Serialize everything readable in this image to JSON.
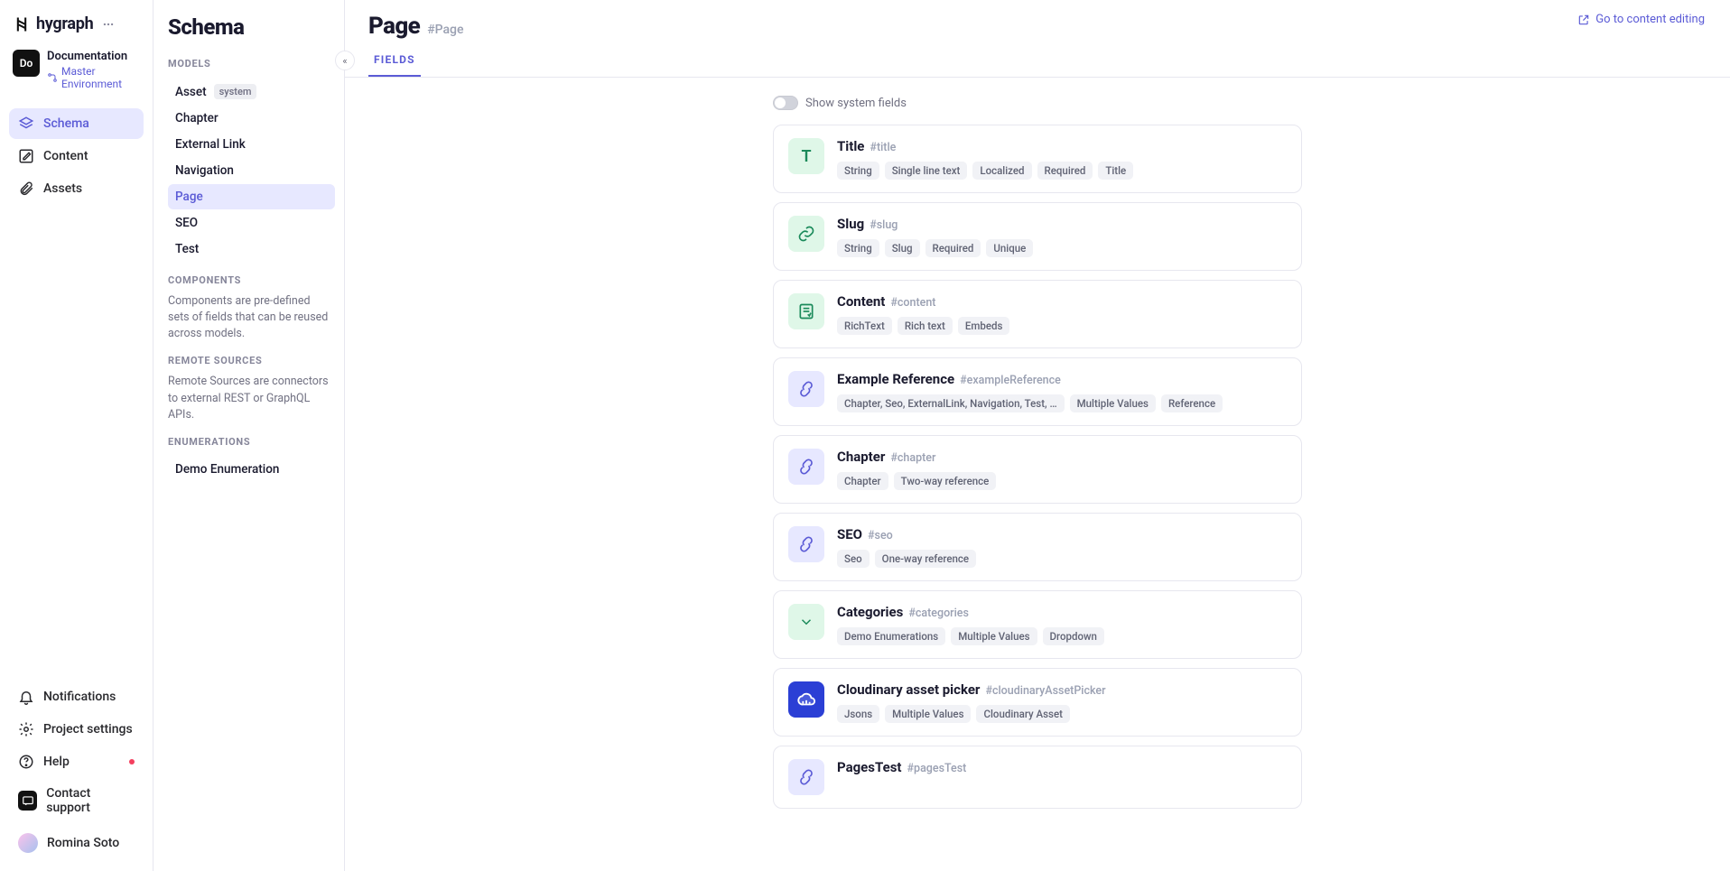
{
  "brand": {
    "name": "hygraph"
  },
  "workspace": {
    "avatar_text": "Do",
    "name": "Documentation",
    "environment": "Master Environment"
  },
  "nav": {
    "primary": [
      {
        "id": "schema",
        "label": "Schema",
        "active": true,
        "icon": "layers"
      },
      {
        "id": "content",
        "label": "Content",
        "active": false,
        "icon": "edit"
      },
      {
        "id": "assets",
        "label": "Assets",
        "active": false,
        "icon": "paperclip"
      }
    ],
    "bottom": [
      {
        "id": "notifications",
        "label": "Notifications",
        "icon": "bell",
        "badge": false
      },
      {
        "id": "project-settings",
        "label": "Project settings",
        "icon": "gear",
        "badge": false
      },
      {
        "id": "help",
        "label": "Help",
        "icon": "help-circle",
        "badge": true
      },
      {
        "id": "contact-support",
        "label": "Contact support",
        "icon": "message",
        "badge": false
      }
    ],
    "user": {
      "name": "Romina Soto"
    }
  },
  "schema_panel": {
    "title": "Schema",
    "sections": {
      "models": {
        "label": "Models",
        "items": [
          {
            "name": "Asset",
            "system": true,
            "active": false
          },
          {
            "name": "Chapter",
            "system": false,
            "active": false
          },
          {
            "name": "External Link",
            "system": false,
            "active": false
          },
          {
            "name": "Navigation",
            "system": false,
            "active": false
          },
          {
            "name": "Page",
            "system": false,
            "active": true
          },
          {
            "name": "SEO",
            "system": false,
            "active": false
          },
          {
            "name": "Test",
            "system": false,
            "active": false
          }
        ]
      },
      "components": {
        "label": "Components",
        "description": "Components are pre-defined sets of fields that can be reused across models."
      },
      "remote_sources": {
        "label": "Remote Sources",
        "description": "Remote Sources are connectors to external REST or GraphQL APIs."
      },
      "enumerations": {
        "label": "Enumerations",
        "items": [
          {
            "name": "Demo Enumeration"
          }
        ]
      }
    }
  },
  "main": {
    "title": "Page",
    "api_id": "#Page",
    "editing_link": "Go to content editing",
    "tabs": [
      {
        "id": "fields",
        "label": "FIELDS",
        "active": true
      }
    ],
    "show_system_label": "Show system fields",
    "show_system": false,
    "fields": [
      {
        "icon_text": "T",
        "icon_class": "bg-green",
        "icon_svg": null,
        "name": "Title",
        "api": "#title",
        "tags": [
          "String",
          "Single line text",
          "Localized",
          "Required",
          "Title"
        ]
      },
      {
        "icon_text": null,
        "icon_class": "bg-green",
        "icon_svg": "link",
        "name": "Slug",
        "api": "#slug",
        "tags": [
          "String",
          "Slug",
          "Required",
          "Unique"
        ]
      },
      {
        "icon_text": null,
        "icon_class": "bg-green",
        "icon_svg": "richtext",
        "name": "Content",
        "api": "#content",
        "tags": [
          "RichText",
          "Rich text",
          "Embeds"
        ]
      },
      {
        "icon_text": null,
        "icon_class": "bg-indigo",
        "icon_svg": "ref",
        "name": "Example Reference",
        "api": "#exampleReference",
        "tags": [
          "Chapter, Seo, ExternalLink, Navigation, Test, …",
          "Multiple Values",
          "Reference"
        ]
      },
      {
        "icon_text": null,
        "icon_class": "bg-indigo",
        "icon_svg": "ref",
        "name": "Chapter",
        "api": "#chapter",
        "tags": [
          "Chapter",
          "Two-way reference"
        ]
      },
      {
        "icon_text": null,
        "icon_class": "bg-indigo",
        "icon_svg": "ref",
        "name": "SEO",
        "api": "#seo",
        "tags": [
          "Seo",
          "One-way reference"
        ]
      },
      {
        "icon_text": null,
        "icon_class": "bg-green",
        "icon_svg": "dropdown",
        "name": "Categories",
        "api": "#categories",
        "tags": [
          "Demo Enumerations",
          "Multiple Values",
          "Dropdown"
        ]
      },
      {
        "icon_text": null,
        "icon_class": "bg-blue",
        "icon_svg": "cloud",
        "name": "Cloudinary asset picker",
        "api": "#cloudinaryAssetPicker",
        "tags": [
          "Jsons",
          "Multiple Values",
          "Cloudinary Asset"
        ]
      },
      {
        "icon_text": null,
        "icon_class": "bg-indigo",
        "icon_svg": "ref",
        "name": "PagesTest",
        "api": "#pagesTest",
        "tags": []
      }
    ]
  }
}
